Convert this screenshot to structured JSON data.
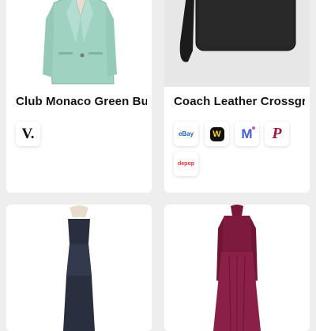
{
  "products": [
    {
      "title": "Club Monaco Green Bu...",
      "image": "mint green blazer on dress form",
      "marketplaces": [
        {
          "name": "Vestiaire",
          "glyph": "V.",
          "icon": "vestiaire-logo-icon"
        }
      ]
    },
    {
      "title": "Coach Leather Crossgr...",
      "image": "black leather wristlet pouch",
      "marketplaces": [
        {
          "name": "eBay",
          "glyph": "eBay",
          "icon": "ebay-logo-icon"
        },
        {
          "name": "Whatnot",
          "glyph": "W",
          "icon": "whatnot-logo-icon"
        },
        {
          "name": "Mercari",
          "glyph": "M",
          "icon": "mercari-logo-icon"
        },
        {
          "name": "Poshmark",
          "glyph": "P",
          "icon": "poshmark-logo-icon"
        },
        {
          "name": "Depop",
          "glyph": "depop",
          "icon": "depop-logo-icon"
        }
      ]
    },
    {
      "title": "",
      "image": "navy velvet strapless gown on dress form",
      "marketplaces": []
    },
    {
      "title": "",
      "image": "burgundy long-sleeve dress on dress form",
      "marketplaces": []
    }
  ],
  "colors": {
    "page_background": "#eeeeee",
    "card_background": "#ffffff",
    "title_text": "#141414"
  }
}
